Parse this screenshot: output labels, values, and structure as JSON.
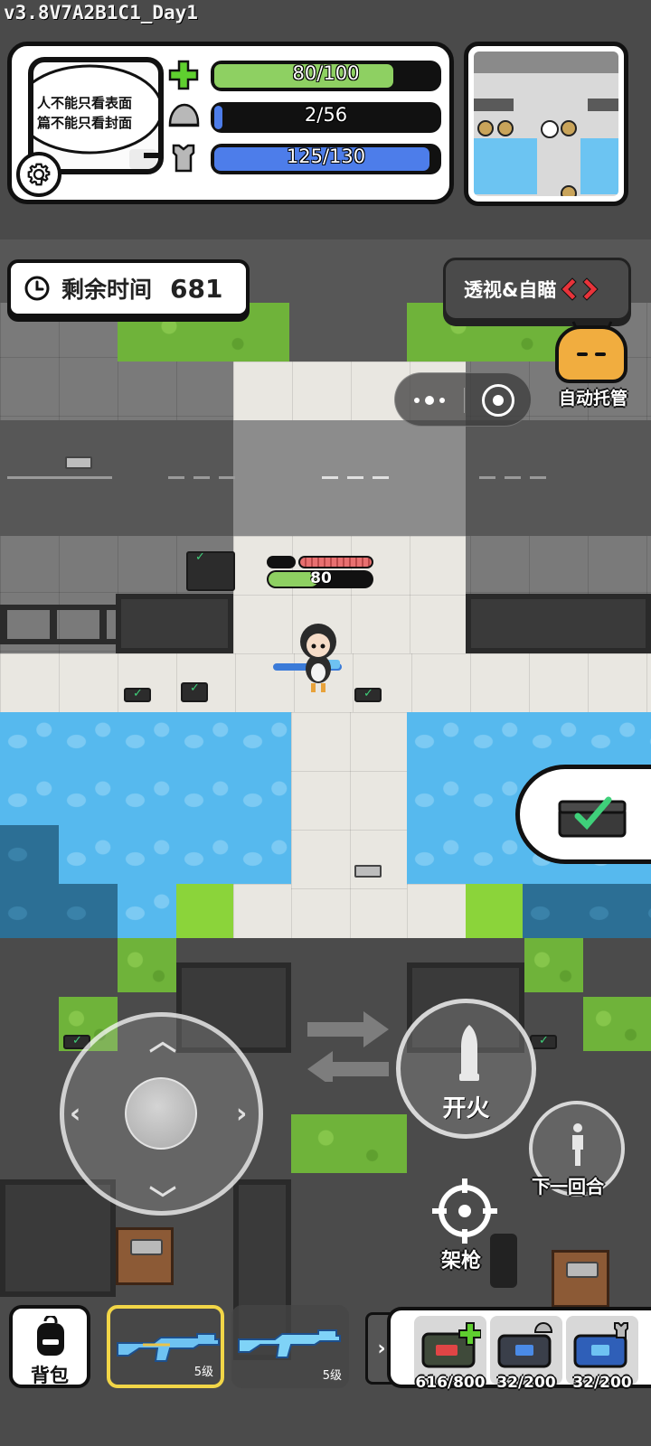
{
  "version": "v3.8V7A2B1C1_Day1",
  "portrait": {
    "line1": "人不能只看表面",
    "line2": "篇不能只看封面"
  },
  "stats": {
    "health": {
      "text": "80/100",
      "current": 80,
      "max": 100,
      "color": "#8ed062"
    },
    "helmet": {
      "text": "2/56",
      "current": 2,
      "max": 56,
      "color": "#4d7dea"
    },
    "armor": {
      "text": "125/130",
      "current": 125,
      "max": 130,
      "color": "#4d7dea"
    }
  },
  "minimap": {
    "markers": [
      "enemy",
      "enemy",
      "player",
      "enemy",
      "enemy"
    ]
  },
  "timer": {
    "label": "剩余时间",
    "value": "681"
  },
  "xray_button": {
    "label": "透视&自瞄"
  },
  "auto_button": {
    "label": "自动托管"
  },
  "player_status": {
    "hp_text": "80"
  },
  "controls": {
    "fire_label": "开火",
    "next_round_label": "下一回合",
    "aim_label": "架枪"
  },
  "inventory": {
    "bag_label": "背包",
    "weapons": [
      {
        "level": "5级",
        "selected": true
      },
      {
        "level": "5级",
        "selected": false
      }
    ],
    "consumables": [
      {
        "icon": "medkit-icon",
        "count": "616/800"
      },
      {
        "icon": "helmet-repair-kit-icon",
        "count": "32/200"
      },
      {
        "icon": "armor-repair-kit-icon",
        "count": "32/200"
      }
    ]
  },
  "colors": {
    "panel_border": "#111111",
    "health": "#8ed062",
    "shield": "#4d7dea",
    "water": "#56b9ee",
    "grass": "#6fb33a"
  }
}
